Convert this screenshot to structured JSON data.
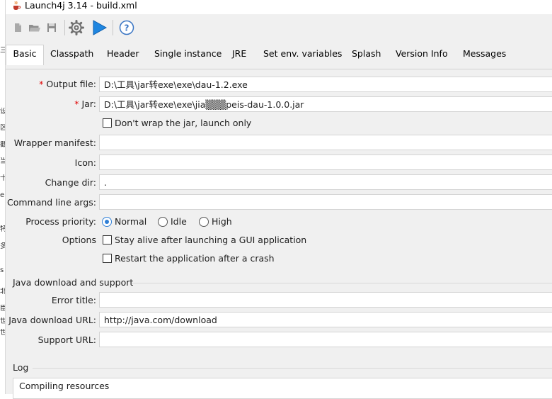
{
  "window": {
    "title": "Launch4j 3.14 - build.xml",
    "icon": "java-cup-icon"
  },
  "left_strip_glyphs": [
    "三",
    "设",
    "区",
    "截",
    "当",
    "十",
    "e",
    "特",
    "多",
    "s",
    "北",
    "臣",
    "世",
    "世"
  ],
  "toolbar": {
    "buttons": [
      {
        "icon": "new-file-icon",
        "name": "new-button"
      },
      {
        "icon": "open-folder-icon",
        "name": "open-button"
      },
      {
        "icon": "save-icon",
        "name": "save-button"
      },
      {
        "icon": "gear-icon",
        "name": "build-wrapper-button"
      },
      {
        "icon": "play-icon",
        "name": "test-wrapper-button"
      },
      {
        "icon": "help-icon",
        "name": "about-button"
      }
    ]
  },
  "tabs": [
    "Basic",
    "Classpath",
    "Header",
    "Single instance",
    "JRE",
    "Set env. variables",
    "Splash",
    "Version Info",
    "Messages"
  ],
  "active_tab": "Basic",
  "basic": {
    "output_file": {
      "label": "Output file:",
      "required_mark": "*",
      "value": "D:\\工具\\jar转exe\\exe\\dau-1.2.exe"
    },
    "jar": {
      "label": "Jar:",
      "required_mark": "*",
      "value": "D:\\工具\\jar转exe\\exe\\jia▒▒▒peis-dau-1.0.0.jar"
    },
    "dont_wrap": {
      "label": "Don't wrap the jar, launch only",
      "checked": false
    },
    "wrapper_manifest": {
      "label": "Wrapper manifest:",
      "value": ""
    },
    "icon": {
      "label": "Icon:",
      "value": ""
    },
    "change_dir": {
      "label": "Change dir:",
      "value": "."
    },
    "cmd_args": {
      "label": "Command line args:",
      "value": ""
    },
    "priority": {
      "label": "Process priority:",
      "options": [
        "Normal",
        "Idle",
        "High"
      ],
      "selected": "Normal"
    },
    "options": {
      "label": "Options",
      "stay_alive": {
        "label": "Stay alive after launching a GUI application",
        "checked": false
      },
      "restart": {
        "label": "Restart the application after a crash",
        "checked": false
      }
    },
    "java_download": {
      "section_title": "Java download and support",
      "error_title": {
        "label": "Error title:",
        "value": ""
      },
      "download_url": {
        "label": "Java download URL:",
        "value": "http://java.com/download"
      },
      "support_url": {
        "label": "Support URL:",
        "value": ""
      }
    }
  },
  "log": {
    "section_title": "Log",
    "lines": [
      "Compiling resources"
    ]
  },
  "colors": {
    "accent": "#2f7fd6",
    "required": "#e00000",
    "panel": "#f0f0f0"
  }
}
